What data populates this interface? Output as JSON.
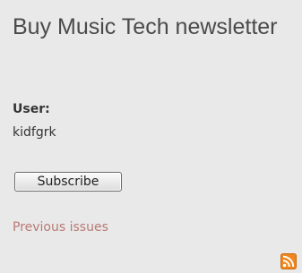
{
  "block": {
    "title": "Buy Music Tech newsletter",
    "user_label": "User:",
    "user_name": "kidfgrk",
    "subscribe_label": "Subscribe",
    "previous_link": "Previous issues",
    "feed_icon": "rss-feed-icon"
  },
  "colors": {
    "background": "#e9e9e9",
    "title_text": "#4a4a4a",
    "link": "#b87a74",
    "rss_orange": "#f0861d"
  }
}
